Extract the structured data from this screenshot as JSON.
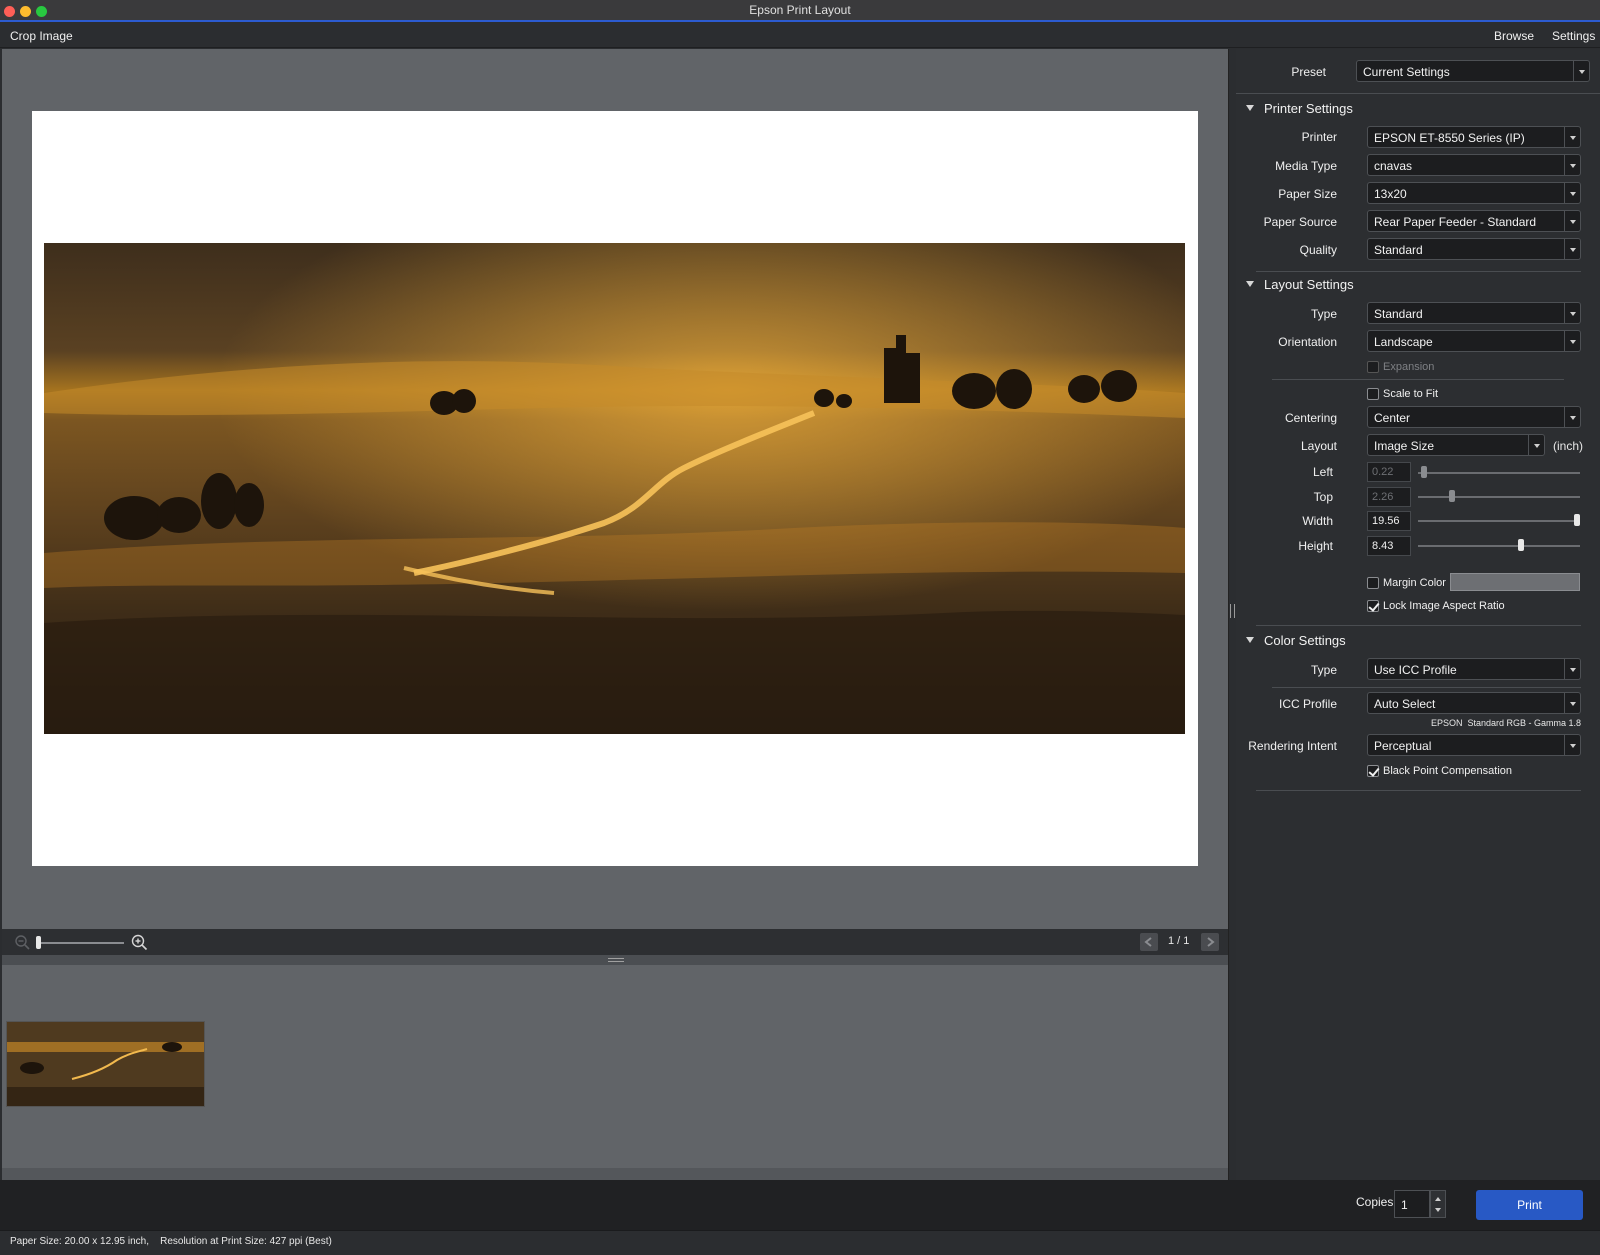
{
  "window": {
    "title": "Epson Print Layout"
  },
  "menubar": {
    "left": "Crop Image",
    "browse": "Browse",
    "settings": "Settings"
  },
  "preview": {
    "page_indicator": "1 / 1",
    "zoom_level": 0.0
  },
  "panel": {
    "preset": {
      "label": "Preset",
      "value": "Current Settings"
    },
    "printer_settings": {
      "title": "Printer Settings",
      "printer": {
        "label": "Printer",
        "value": "EPSON ET-8550 Series (IP)"
      },
      "media_type": {
        "label": "Media Type",
        "value": "cnavas"
      },
      "paper_size": {
        "label": "Paper Size",
        "value": "13x20"
      },
      "paper_source": {
        "label": "Paper Source",
        "value": "Rear Paper Feeder - Standard"
      },
      "quality": {
        "label": "Quality",
        "value": "Standard"
      }
    },
    "layout_settings": {
      "title": "Layout Settings",
      "type": {
        "label": "Type",
        "value": "Standard"
      },
      "orientation": {
        "label": "Orientation",
        "value": "Landscape"
      },
      "expansion": {
        "label": "Expansion",
        "checked": false,
        "enabled": false
      },
      "scale_to_fit": {
        "label": "Scale to Fit",
        "checked": false
      },
      "centering": {
        "label": "Centering",
        "value": "Center"
      },
      "layout": {
        "label": "Layout",
        "value": "Image Size",
        "unit": "(inch)"
      },
      "left": {
        "label": "Left",
        "value": "0.22",
        "slider_fraction": 0.02
      },
      "top": {
        "label": "Top",
        "value": "2.26",
        "slider_fraction": 0.2
      },
      "width": {
        "label": "Width",
        "value": "19.56",
        "slider_fraction": 1.0
      },
      "height": {
        "label": "Height",
        "value": "8.43",
        "slider_fraction": 0.64
      },
      "margin_color": {
        "label": "Margin Color",
        "checked": false
      },
      "lock_aspect": {
        "label": "Lock Image Aspect Ratio",
        "checked": true
      }
    },
    "color_settings": {
      "title": "Color Settings",
      "type": {
        "label": "Type",
        "value": "Use ICC Profile"
      },
      "icc_profile": {
        "label": "ICC Profile",
        "value": "Auto Select",
        "note": "EPSON  Standard RGB - Gamma 1.8"
      },
      "rendering_intent": {
        "label": "Rendering Intent",
        "value": "Perceptual"
      },
      "black_point": {
        "label": "Black Point Compensation",
        "checked": true
      }
    }
  },
  "bottom": {
    "copies_label": "Copies",
    "copies_value": "1",
    "print_label": "Print"
  },
  "status": {
    "text": "Paper Size: 20.00 x 12.95 inch,    Resolution at Print Size: 427 ppi (Best)"
  },
  "colors": {
    "accent": "#2859c5",
    "panel_bg": "#2c2e31",
    "preview_bg": "#616468"
  }
}
